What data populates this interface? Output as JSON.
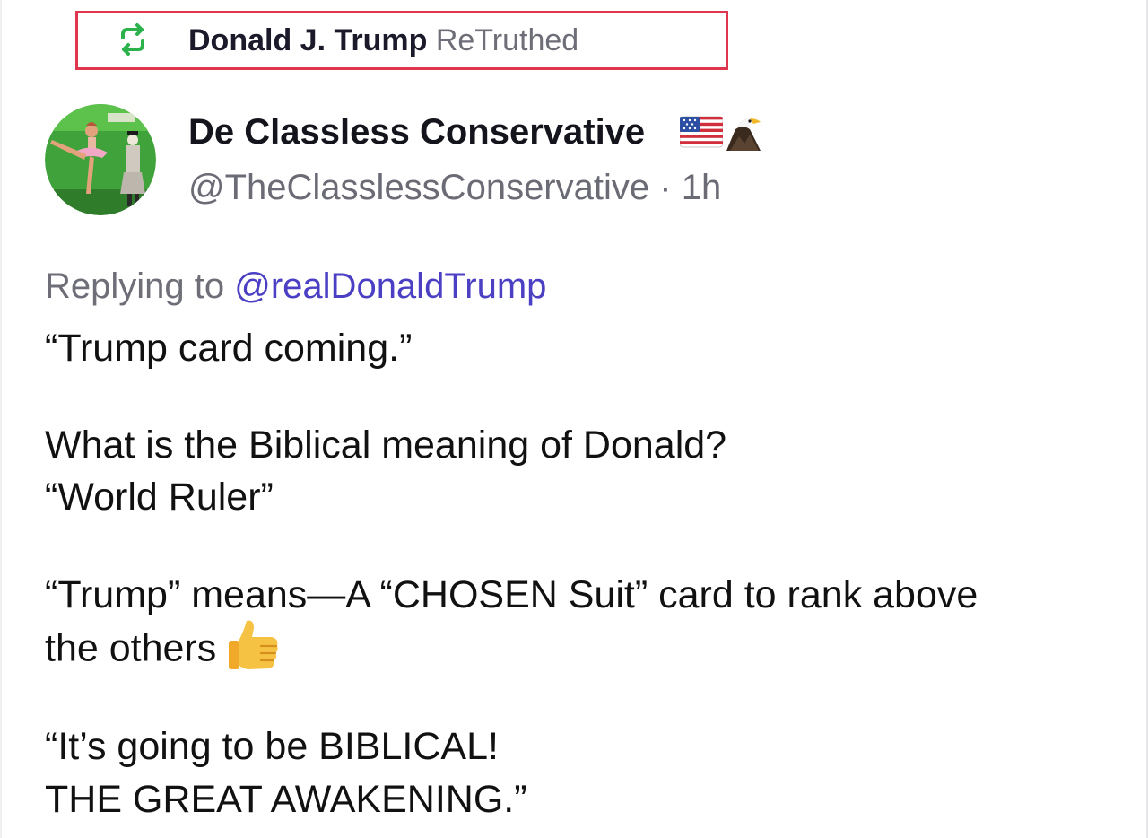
{
  "retruth": {
    "icon": "retruth-icon",
    "name": "Donald J. Trump",
    "label": "ReTruthed",
    "accent": "#2bb24c",
    "highlight_border": "#e0354f"
  },
  "author": {
    "avatar": "avatar",
    "display_name": "De Classless Conservative",
    "badges": [
      "us-flag-icon",
      "eagle-icon"
    ],
    "handle": "@TheClasslessConservative",
    "separator": "·",
    "time": "1h"
  },
  "post": {
    "replying_prefix": "Replying to",
    "replying_to": "@realDonaldTrump",
    "mention_color": "#4b3fc4",
    "lines": [
      "“Trump card coming.”",
      "What is the Biblical meaning of Donald?",
      "“World Ruler”",
      "“Trump” means—A “CHOSEN Suit” card to rank above",
      "the others",
      "“It’s going to be BIBLICAL!",
      "THE GREAT AWAKENING.”"
    ],
    "emoji": "thumbs-up-icon"
  }
}
